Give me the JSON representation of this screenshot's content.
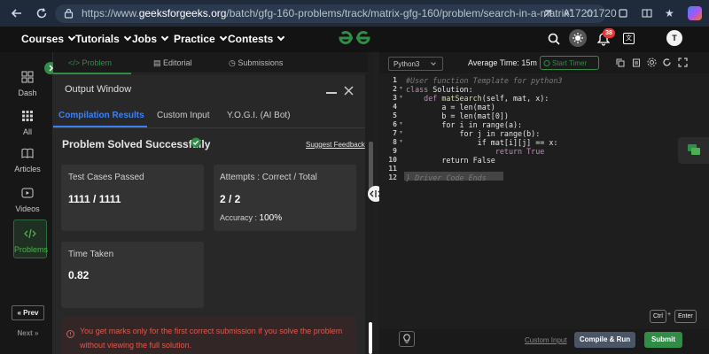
{
  "browser": {
    "url_prefix": "https://www.",
    "url_domain": "geeksforgeeks.org",
    "url_path": "/batch/gfg-160-problems/track/matrix-gfg-160/problem/search-in-a-matrix17201720"
  },
  "nav": {
    "items": [
      "Courses",
      "Tutorials",
      "Jobs",
      "Practice",
      "Contests"
    ],
    "notifications_count": "38",
    "avatar_initial": "T"
  },
  "sidebar": {
    "items": [
      "Dash",
      "All",
      "Articles",
      "Videos",
      "Problems"
    ],
    "prev_label": "Prev",
    "next_label": "Next"
  },
  "tabs": {
    "problem": "Problem",
    "editorial": "Editorial",
    "submissions": "Submissions"
  },
  "output": {
    "title": "Output Window",
    "subtabs": [
      "Compilation Results",
      "Custom Input",
      "Y.O.G.I. (AI Bot)"
    ],
    "status": "Problem Solved Successfully",
    "suggest_feedback": "Suggest Feedback",
    "test_cases_label": "Test Cases Passed",
    "test_cases_value": "1111 / 1111",
    "attempts_label": "Attempts : Correct / Total",
    "attempts_value": "2 / 2",
    "accuracy_label": "Accuracy :",
    "accuracy_value": "100%",
    "time_label": "Time Taken",
    "time_value": "0.82",
    "notice": "You get marks only for the first correct submission if you solve the problem without viewing the full solution."
  },
  "editor": {
    "language": "Python3",
    "avg_time": "Average Time: 15m",
    "start_timer": "Start Timer",
    "line_numbers": [
      "1",
      "2",
      "3",
      "4",
      "5",
      "6",
      "7",
      "8",
      "9",
      "10",
      "11",
      "12"
    ],
    "code": {
      "l1": "#User function Template for python3",
      "l2_kw": "class",
      "l2_rest": " Solution:",
      "l3_kw": "    def",
      "l3_fn": " matSearch",
      "l3_rest": "(self, mat, x):",
      "l4": "        a = len(mat)",
      "l5": "        b = len(mat[0])",
      "l6": "        for i in range(a):",
      "l7": "            for j in range(b):",
      "l8": "                if mat[i][j] == x:",
      "l9": "                    return True",
      "l10": "        return False",
      "l12": "} Driver Code Ends"
    },
    "shortcut_ctrl": "Ctrl",
    "shortcut_plus": "+",
    "shortcut_enter": "Enter",
    "custom_input": "Custom Input",
    "compile_run": "Compile & Run",
    "submit": "Submit"
  },
  "colors": {
    "accent_green": "#2f8d46",
    "accent_blue": "#3b82f6",
    "error_red": "#e05a4e"
  }
}
